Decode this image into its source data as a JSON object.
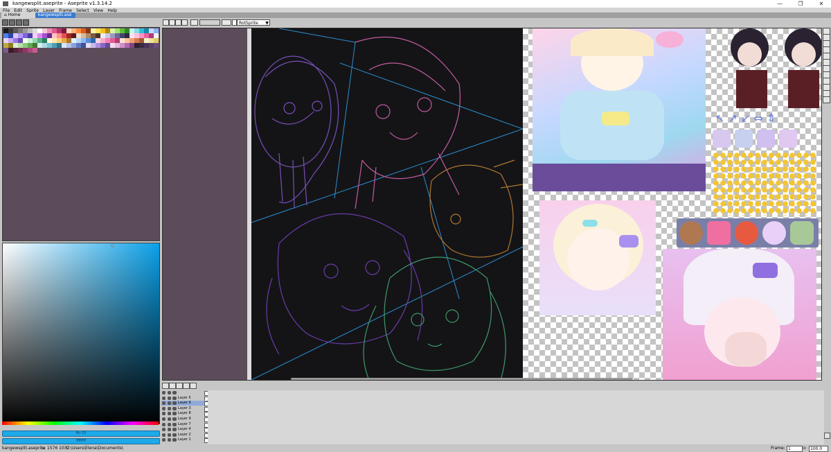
{
  "window": {
    "title": "kangewsplit.aseprite - Aseprite v1.3.14.2",
    "controls": [
      "—",
      "❐",
      "✕"
    ]
  },
  "menu": [
    "File",
    "Edit",
    "Sprite",
    "Layer",
    "Frame",
    "Select",
    "View",
    "Help"
  ],
  "tabs": [
    {
      "label": "Home",
      "active": false
    },
    {
      "label": "kangewsplit.ase",
      "active": true
    }
  ],
  "toolbar": {
    "sprite_select": "RotSprite",
    "zoom_field": "100"
  },
  "palette": {
    "colors": [
      "#1a1a1a",
      "#3b3b3b",
      "#5b5b5b",
      "#7a7a7a",
      "#9a9a9a",
      "#bcbcbc",
      "#dcdcdc",
      "#ffffff",
      "#f7c4d8",
      "#f08cb4",
      "#e05a8e",
      "#b8336a",
      "#7a1a42",
      "#ffd9b8",
      "#ffb27a",
      "#ff8a3d",
      "#d85f1e",
      "#8a3510",
      "#fff6a8",
      "#ffe45c",
      "#f2c21f",
      "#b88a00",
      "#d9f7b0",
      "#a6e36a",
      "#5cbf3a",
      "#2e8a22",
      "#c8f3f0",
      "#7fe0e6",
      "#2fbfd0",
      "#168aa8",
      "#c4dcff",
      "#8cb4ff",
      "#4f7ce8",
      "#2c46b0",
      "#d8c8ff",
      "#b09aff",
      "#7e62e0",
      "#4b3aa8",
      "#f4d0ff",
      "#d98af0",
      "#a64fd0",
      "#6a2a8a",
      "#ffc2c2",
      "#ff8f8f",
      "#e65050",
      "#a02828",
      "#5e1a1a",
      "#f0e0d0",
      "#d8b89a",
      "#b08a6a",
      "#7a5a40",
      "#4a3426",
      "#ebebf5",
      "#c8c8e0",
      "#9a9ac0",
      "#6a6a98",
      "#44446a",
      "#2a2a44",
      "#ffe0f0",
      "#ffc0e0",
      "#ff90c8",
      "#e8609e",
      "#b03a78",
      "#faf0ff",
      "#e8d0ff",
      "#c8a8f8",
      "#9878e0",
      "#6848b8",
      "#f0fff0",
      "#c8f0d8",
      "#90d8b0",
      "#58b088",
      "#2a8060",
      "#fff8e0",
      "#ffe8b0",
      "#ffd078",
      "#e8a848",
      "#b07828",
      "#e0f0ff",
      "#b8d8f8",
      "#88b8f0",
      "#5890d8",
      "#3068b0",
      "#fcd5e5",
      "#f9aacb",
      "#f480b2",
      "#e35a95",
      "#b23b73",
      "#fde3d2",
      "#fbc3a0",
      "#f29e72",
      "#d07a4f",
      "#a05a35",
      "#f7f1c9",
      "#efe29a",
      "#e1cd63",
      "#bfa93a",
      "#8f7c1f",
      "#dcefd4",
      "#b7dfa8",
      "#8dc97b",
      "#62a853",
      "#3f7a34",
      "#d5eef1",
      "#a9dbe3",
      "#78c2d0",
      "#4e9fb3",
      "#2f7489",
      "#dbe2f5",
      "#b5c3ea",
      "#8aa0da",
      "#6078c0",
      "#3f5495",
      "#e6ddf5",
      "#cbb9ea",
      "#ab90da",
      "#8a68c4",
      "#664a9a",
      "#f2dcee",
      "#e4b8dd",
      "#cf8fc8",
      "#b067ab",
      "#7f4580",
      "#2a2030",
      "#3a2a44",
      "#4a3458",
      "#5a406a",
      "#6a4c7c",
      "#7a5a8e",
      "#3a1a24",
      "#52243a",
      "#6e2e4e",
      "#8c3a64",
      "#aa4a7a",
      "#c85c90"
    ]
  },
  "color_bars": {
    "foreground": "ffc-33",
    "background": "ffffffff"
  },
  "timeline": {
    "layers": [
      {
        "name": "",
        "active": false
      },
      {
        "name": "Layer 5",
        "active": false
      },
      {
        "name": "Layer 6",
        "active": true
      },
      {
        "name": "Layer 3",
        "active": false
      },
      {
        "name": "Layer 8",
        "active": false
      },
      {
        "name": "Layer 9",
        "active": false
      },
      {
        "name": "Layer 7",
        "active": false
      },
      {
        "name": "Layer 4",
        "active": false
      },
      {
        "name": "Layer 2",
        "active": false
      },
      {
        "name": "Layer 1",
        "active": false
      }
    ]
  },
  "status": {
    "file": "kangewsplit.aseprite",
    "size": "1576 1032",
    "path": "C:\\Users\\Elena\\Documents\\",
    "frame_label": "Frame:",
    "frame_value": "1",
    "zoom": "100.0"
  },
  "colors": {
    "canvas_bg": "#5c4c5a",
    "art_bg": "#141417",
    "accent": "#1ea9e8"
  }
}
